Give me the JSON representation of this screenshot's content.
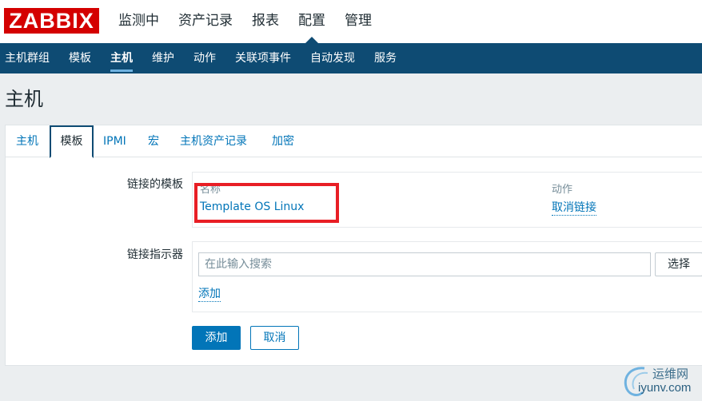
{
  "logo": "ZABBIX",
  "top_nav": [
    {
      "label": "监测中"
    },
    {
      "label": "资产记录"
    },
    {
      "label": "报表"
    },
    {
      "label": "配置"
    },
    {
      "label": "管理"
    }
  ],
  "sub_nav": [
    {
      "label": "主机群组"
    },
    {
      "label": "模板"
    },
    {
      "label": "主机"
    },
    {
      "label": "维护"
    },
    {
      "label": "动作"
    },
    {
      "label": "关联项事件"
    },
    {
      "label": "自动发现"
    },
    {
      "label": "服务"
    }
  ],
  "page_title": "主机",
  "tabs": [
    {
      "label": "主机"
    },
    {
      "label": "模板"
    },
    {
      "label": "IPMI"
    },
    {
      "label": "宏"
    },
    {
      "label": "主机资产记录"
    },
    {
      "label": "加密"
    }
  ],
  "linked_templates": {
    "label": "链接的模板",
    "col_name": "名称",
    "col_action": "动作",
    "rows": [
      {
        "name": "Template OS Linux",
        "action": "取消链接"
      }
    ]
  },
  "link_new": {
    "label": "链接指示器",
    "search_placeholder": "在此输入搜索",
    "select_label": "选择",
    "add_link_label": "添加"
  },
  "buttons": {
    "add": "添加",
    "cancel": "取消"
  },
  "watermark": {
    "cn": "运维网",
    "en": "iyunv.com"
  },
  "colors": {
    "brand_red": "#d40000",
    "nav_blue": "#0e4b73",
    "link_blue": "#0275b8",
    "highlight_red": "#e81e25"
  }
}
